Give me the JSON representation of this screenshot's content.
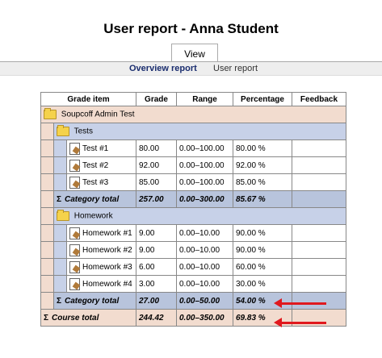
{
  "page": {
    "title": "User report - Anna Student"
  },
  "tabs": {
    "view": "View"
  },
  "subnav": {
    "overview": "Overview report",
    "user": "User report"
  },
  "table": {
    "headers": [
      "Grade item",
      "Grade",
      "Range",
      "Percentage",
      "Feedback"
    ],
    "course": {
      "name": "Soupcoff Admin Test"
    },
    "categories": [
      {
        "name": "Tests",
        "items": [
          {
            "name": "Test #1",
            "grade": "80.00",
            "range": "0.00–100.00",
            "percentage": "80.00 %"
          },
          {
            "name": "Test #2",
            "grade": "92.00",
            "range": "0.00–100.00",
            "percentage": "92.00 %"
          },
          {
            "name": "Test #3",
            "grade": "85.00",
            "range": "0.00–100.00",
            "percentage": "85.00 %"
          }
        ],
        "total": {
          "label": "Category total",
          "grade": "257.00",
          "range": "0.00–300.00",
          "percentage": "85.67 %"
        }
      },
      {
        "name": "Homework",
        "items": [
          {
            "name": "Homework #1",
            "grade": "9.00",
            "range": "0.00–10.00",
            "percentage": "90.00 %"
          },
          {
            "name": "Homework #2",
            "grade": "9.00",
            "range": "0.00–10.00",
            "percentage": "90.00 %"
          },
          {
            "name": "Homework #3",
            "grade": "6.00",
            "range": "0.00–10.00",
            "percentage": "60.00 %"
          },
          {
            "name": "Homework #4",
            "grade": "3.00",
            "range": "0.00–10.00",
            "percentage": "30.00 %"
          }
        ],
        "total": {
          "label": "Category total",
          "grade": "27.00",
          "range": "0.00–50.00",
          "percentage": "54.00 %"
        }
      }
    ],
    "course_total": {
      "label": "Course total",
      "grade": "244.42",
      "range": "0.00–350.00",
      "percentage": "69.83 %"
    }
  },
  "icons": {
    "folder": "folder-icon",
    "item": "grade-item-icon",
    "sigma": "sigma-icon",
    "arrow": "red-arrow-annotation"
  },
  "colors": {
    "course_bg": "#f2dccf",
    "category_bg": "#c7d1e8",
    "total_bg": "#b8c4dc",
    "arrow": "#e0191e"
  }
}
